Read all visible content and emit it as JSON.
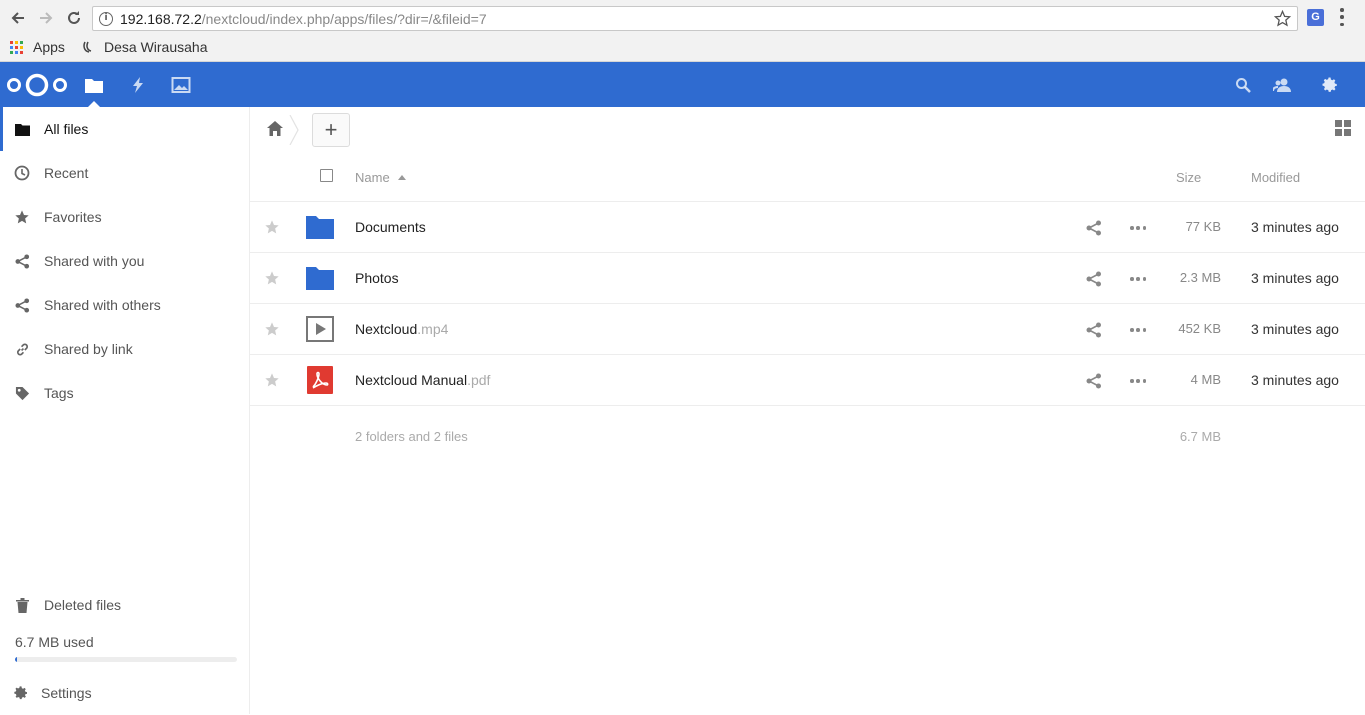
{
  "browser": {
    "url_host": "192.168.72.2",
    "url_path": "/nextcloud/index.php/apps/files/?dir=/&fileid=7",
    "ext_icon_label": "G",
    "bookmarks": [
      {
        "label": "Apps"
      },
      {
        "label": "Desa Wirausaha"
      }
    ]
  },
  "header": {
    "brand_color": "#2f6bd0",
    "apps": [
      {
        "icon": "folder-icon",
        "name": "Files",
        "active": true
      },
      {
        "icon": "activity-icon",
        "name": "Activity"
      },
      {
        "icon": "gallery-icon",
        "name": "Gallery"
      }
    ],
    "right_icons": [
      "search-icon",
      "contacts-icon",
      "settings-gear-icon"
    ]
  },
  "sidebar": {
    "items": [
      {
        "label": "All files",
        "icon": "folder-icon",
        "active": true
      },
      {
        "label": "Recent",
        "icon": "clock-icon"
      },
      {
        "label": "Favorites",
        "icon": "star-icon"
      },
      {
        "label": "Shared with you",
        "icon": "share-icon"
      },
      {
        "label": "Shared with others",
        "icon": "share-icon"
      },
      {
        "label": "Shared by link",
        "icon": "link-icon"
      },
      {
        "label": "Tags",
        "icon": "tag-icon"
      }
    ],
    "deleted_label": "Deleted files",
    "quota_label": "6.7 MB used",
    "quota_fraction": 0.01,
    "settings_label": "Settings"
  },
  "main": {
    "new_button": "+",
    "columns": {
      "name": "Name",
      "size": "Size",
      "modified": "Modified"
    },
    "files": [
      {
        "name": "Documents",
        "ext": "",
        "type": "folder",
        "size": "77 KB",
        "modified": "3 minutes ago"
      },
      {
        "name": "Photos",
        "ext": "",
        "type": "folder",
        "size": "2.3 MB",
        "modified": "3 minutes ago"
      },
      {
        "name": "Nextcloud",
        "ext": ".mp4",
        "type": "video",
        "size": "452 KB",
        "modified": "3 minutes ago"
      },
      {
        "name": "Nextcloud Manual",
        "ext": ".pdf",
        "type": "pdf",
        "size": "4 MB",
        "modified": "3 minutes ago"
      }
    ],
    "summary_files": "2 folders and 2 files",
    "summary_size": "6.7 MB"
  }
}
